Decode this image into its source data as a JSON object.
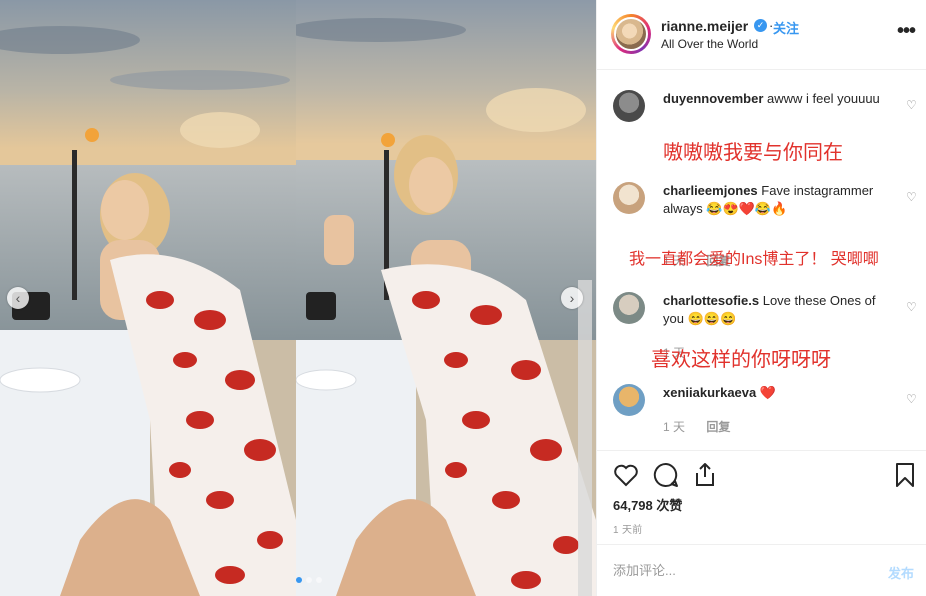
{
  "post": {
    "username": "rianne.meijer",
    "follow_label": "关注",
    "location": "All Over the World",
    "more_label": "•••"
  },
  "comments": [
    {
      "username": "duyennovember",
      "text": "awww i feel youuuu",
      "overlay": "嗷嗷嗷我要与你同在"
    },
    {
      "username": "charlieemjones",
      "text": "Fave instagrammer always 😂😍❤️😂🔥",
      "overlay": "我一直都会爱的Ins博主了！ 哭唧唧",
      "meta_time": "1 天",
      "meta_reply": "回复"
    },
    {
      "username": "charlottesofie.s",
      "text": "Love these Ones of you 😄😄😄",
      "overlay": "喜欢这样的你呀呀呀",
      "meta_time": "1 天"
    },
    {
      "username": "xeniiakurkaeva",
      "text": "❤️",
      "meta_time": "1 天",
      "meta_reply": "回复"
    }
  ],
  "footer": {
    "likes": "64,798 次赞",
    "time_ago": "1 天前",
    "comment_placeholder": "添加评论...",
    "post_label": "发布"
  },
  "colors": {
    "accent": "#3897f0",
    "overlay_red": "#e1322c"
  }
}
